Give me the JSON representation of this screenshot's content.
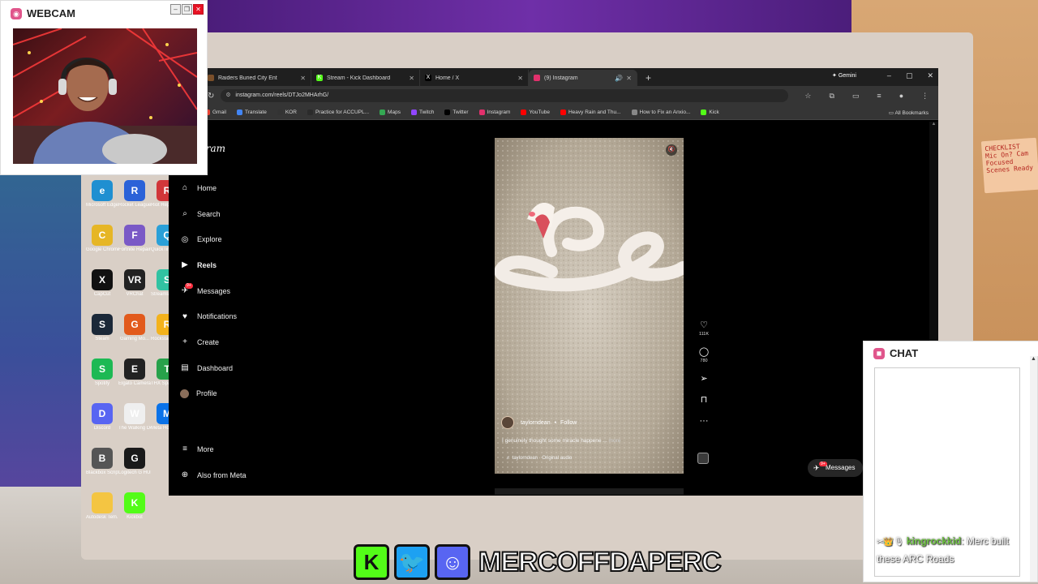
{
  "colors": {
    "accent_pink": "#e0558b",
    "ig_badge": "#ff3040",
    "kick_green": "#53fc18",
    "twitter_blue": "#1da1f2",
    "discord_purple": "#5865f2"
  },
  "sticky_note": {
    "text": "CHECKLIST Mic On? Cam Focused Scenes Ready"
  },
  "desktop": {
    "icons": [
      {
        "label": "Microsoft Edge",
        "icon": "edge-icon",
        "color": "#1f8fd1",
        "glyph": "e"
      },
      {
        "label": "Rocket League",
        "icon": "rocket-league-icon",
        "color": "#2b62d8",
        "glyph": "R"
      },
      {
        "label": "Riot Repair Tool",
        "icon": "riot-icon",
        "color": "#d13639",
        "glyph": "R"
      },
      {
        "label": "Google Chrome",
        "icon": "chrome-icon",
        "color": "#e6b626",
        "glyph": "C"
      },
      {
        "label": "Fortnite Repair Tool",
        "icon": "fortnite-icon",
        "color": "#7a59c6",
        "glyph": "F"
      },
      {
        "label": "QuickTime Player",
        "icon": "quicktime-icon",
        "color": "#2aa0d8",
        "glyph": "Q"
      },
      {
        "label": "CapCut",
        "icon": "capcut-icon",
        "color": "#111111",
        "glyph": "X"
      },
      {
        "label": "VRChat",
        "icon": "vrchat-icon",
        "color": "#222222",
        "glyph": "VR"
      },
      {
        "label": "Streamlabs Desktop",
        "icon": "streamlabs-icon",
        "color": "#31c3a2",
        "glyph": "S"
      },
      {
        "label": "Steam",
        "icon": "steam-icon",
        "color": "#1b2838",
        "glyph": "S"
      },
      {
        "label": "Gaming Mo...",
        "icon": "gaming-icon",
        "color": "#e25a1c",
        "glyph": "G"
      },
      {
        "label": "Rockstar Games",
        "icon": "rockstar-icon",
        "color": "#f3b21c",
        "glyph": "R"
      },
      {
        "label": "Spotify",
        "icon": "spotify-icon",
        "color": "#1db954",
        "glyph": "S"
      },
      {
        "label": "Elgato Camera Hub",
        "icon": "elgato-icon",
        "color": "#222222",
        "glyph": "E"
      },
      {
        "label": "THX Spatial Audio",
        "icon": "thx-icon",
        "color": "#27a14a",
        "glyph": "T"
      },
      {
        "label": "Discord",
        "icon": "discord-icon",
        "color": "#5865f2",
        "glyph": "D"
      },
      {
        "label": "The Walking Dead The...",
        "icon": "walking-dead-icon",
        "color": "#efefef",
        "glyph": "W"
      },
      {
        "label": "Meta Horizon Link",
        "icon": "meta-icon",
        "color": "#0a72e8",
        "glyph": "M"
      },
      {
        "label": "Blackbox Script 4",
        "icon": "blackbox-icon",
        "color": "#555555",
        "glyph": "B"
      },
      {
        "label": "Logitech G HUB",
        "icon": "logitech-icon",
        "color": "#1a1a1a",
        "glyph": "G"
      },
      {
        "label": "",
        "icon": "blank-icon",
        "color": "transparent",
        "glyph": ""
      },
      {
        "label": "Autodesk Tem...",
        "icon": "folder-icon",
        "color": "#f4c542",
        "glyph": ""
      },
      {
        "label": "Kickbot",
        "icon": "kick-icon",
        "color": "#53fc18",
        "glyph": "K"
      }
    ]
  },
  "browser": {
    "tabs": [
      {
        "title": "Raiders Buried City Ent",
        "icon": "game-tab-icon",
        "color": "#7a4f2a",
        "glyph": ""
      },
      {
        "title": "Stream - Kick Dashboard",
        "icon": "kick-tab-icon",
        "color": "#53fc18",
        "glyph": "K"
      },
      {
        "title": "Home / X",
        "icon": "x-tab-icon",
        "color": "#000000",
        "glyph": "X"
      },
      {
        "title": "(9) Instagram",
        "icon": "instagram-tab-icon",
        "color": "#e1306c",
        "glyph": "",
        "active": true
      }
    ],
    "gemini_label": "Gemini",
    "url": "instagram.com/reels/DTJo2MHArhG/",
    "bookmarks": [
      {
        "label": "Gmail",
        "color": "#ea4335"
      },
      {
        "label": "Translate",
        "color": "#4285f4"
      },
      {
        "label": "KOR",
        "color": "#333333"
      },
      {
        "label": "Practice for ACCUPL...",
        "color": "#2b2b2b"
      },
      {
        "label": "Maps",
        "color": "#34a853"
      },
      {
        "label": "Twitch",
        "color": "#9146ff"
      },
      {
        "label": "Twitter",
        "color": "#000000"
      },
      {
        "label": "Instagram",
        "color": "#e1306c"
      },
      {
        "label": "YouTube",
        "color": "#ff0000"
      },
      {
        "label": "Heavy Rain and Thu...",
        "color": "#ff0000"
      },
      {
        "label": "How to Fix an Anxio...",
        "color": "#888888"
      },
      {
        "label": "Kick",
        "color": "#53fc18"
      }
    ],
    "all_bookmarks": "All Bookmarks"
  },
  "instagram": {
    "logo": "Instagram",
    "nav": [
      {
        "label": "Home",
        "icon": "home-icon",
        "glyph": "⌂"
      },
      {
        "label": "Search",
        "icon": "search-icon",
        "glyph": "⌕"
      },
      {
        "label": "Explore",
        "icon": "compass-icon",
        "glyph": "◎"
      },
      {
        "label": "Reels",
        "icon": "reels-icon",
        "glyph": "▶",
        "bold": true
      },
      {
        "label": "Messages",
        "icon": "messages-icon",
        "glyph": "✈",
        "badge": "9+"
      },
      {
        "label": "Notifications",
        "icon": "heart-icon",
        "glyph": "♥"
      },
      {
        "label": "Create",
        "icon": "plus-icon",
        "glyph": "+"
      },
      {
        "label": "Dashboard",
        "icon": "dashboard-icon",
        "glyph": "▤"
      },
      {
        "label": "Profile",
        "icon": "avatar-icon",
        "glyph": ""
      }
    ],
    "nav_bottom": [
      {
        "label": "More",
        "icon": "menu-icon",
        "glyph": "≡"
      },
      {
        "label": "Also from Meta",
        "icon": "meta-icon",
        "glyph": "⊕"
      }
    ],
    "reel": {
      "author": "taylorndean",
      "follow": "Follow",
      "dot": "•",
      "caption": "I genuinely thought some miracle happene ...",
      "more": "more",
      "audio": "♬ taylorndean · Original audio",
      "mute_glyph": "🔇"
    },
    "actions": [
      {
        "name": "like",
        "icon": "heart-outline-icon",
        "glyph": "♡",
        "count": "111K"
      },
      {
        "name": "comment",
        "icon": "comment-icon",
        "glyph": "◯",
        "count": "780"
      },
      {
        "name": "share",
        "icon": "share-icon",
        "glyph": "➢",
        "count": ""
      },
      {
        "name": "save",
        "icon": "bookmark-icon",
        "glyph": "⊓",
        "count": ""
      },
      {
        "name": "more",
        "icon": "more-icon",
        "glyph": "···",
        "count": ""
      }
    ],
    "messages_pill": {
      "label": "Messages",
      "badge": "9+"
    }
  },
  "webcam": {
    "title": "WEBCAM"
  },
  "chat": {
    "title": "CHAT",
    "message": {
      "emotes": "✂👑🎙",
      "user": "kingrockkid",
      "text": ": Merc built these ARC Roads"
    }
  },
  "socials": {
    "handle": "MERCOFFDAPERC"
  }
}
